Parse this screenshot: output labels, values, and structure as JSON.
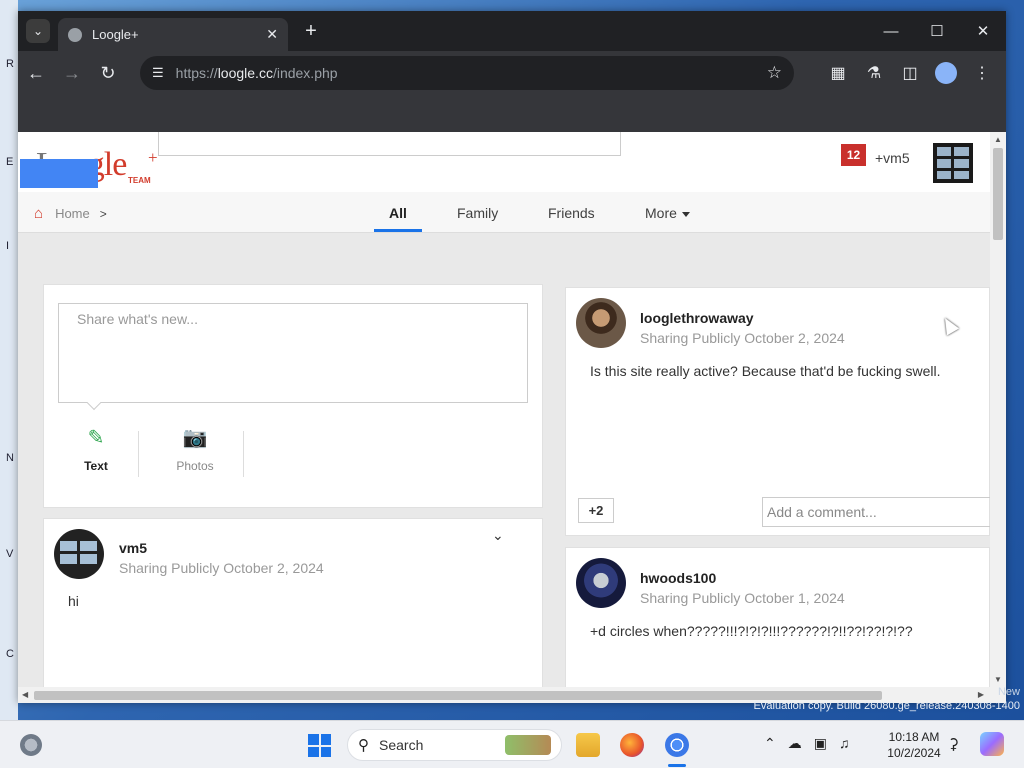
{
  "desktop": {
    "edge_letters": [
      "R",
      "E",
      "I",
      "N",
      "V",
      "C"
    ]
  },
  "browser": {
    "tab_title": "Loogle+",
    "url_prefix": "https://",
    "url_host": "loogle.cc",
    "url_path": "/index.php"
  },
  "site": {
    "logo_text_gray": "L",
    "logo_text_red": "oogle",
    "logo_plus": "+",
    "logo_team": "TEAM",
    "notifications": "12",
    "user_handle": "+vm5",
    "nav": {
      "home": "Home",
      "home_sep": ">",
      "tabs": [
        "All",
        "Family",
        "Friends",
        "More"
      ]
    },
    "share": {
      "placeholder": "Share what's new...",
      "text_label": "Text",
      "photos_label": "Photos"
    },
    "posts": [
      {
        "author": "vm5",
        "visibility": "Sharing Publicly",
        "date": "October 2, 2024",
        "body": "hi"
      },
      {
        "author": "looglethrowaway",
        "visibility": "Sharing Publicly",
        "date": "October 2, 2024",
        "body": "Is this site really active? Because that'd be fucking swell.",
        "plus_count": "+2",
        "comment_placeholder": "Add a comment..."
      },
      {
        "author": "hwoods100",
        "visibility": "Sharing Publicly",
        "date": "October 1, 2024",
        "body": "+d circles when?????!!!?!?!?!!!??????!?!!??!??!?!??"
      }
    ]
  },
  "watermark": {
    "line": "Evaluation copy. Build 26080.ge_release.240308-1400",
    "corner": "New"
  },
  "taskbar": {
    "search_label": "Search",
    "time": "10:18 AM",
    "date": "10/2/2024"
  },
  "colors": {
    "brand_red": "#d23c2c",
    "accent_blue": "#1a73e8",
    "share_green": "#34a853"
  }
}
